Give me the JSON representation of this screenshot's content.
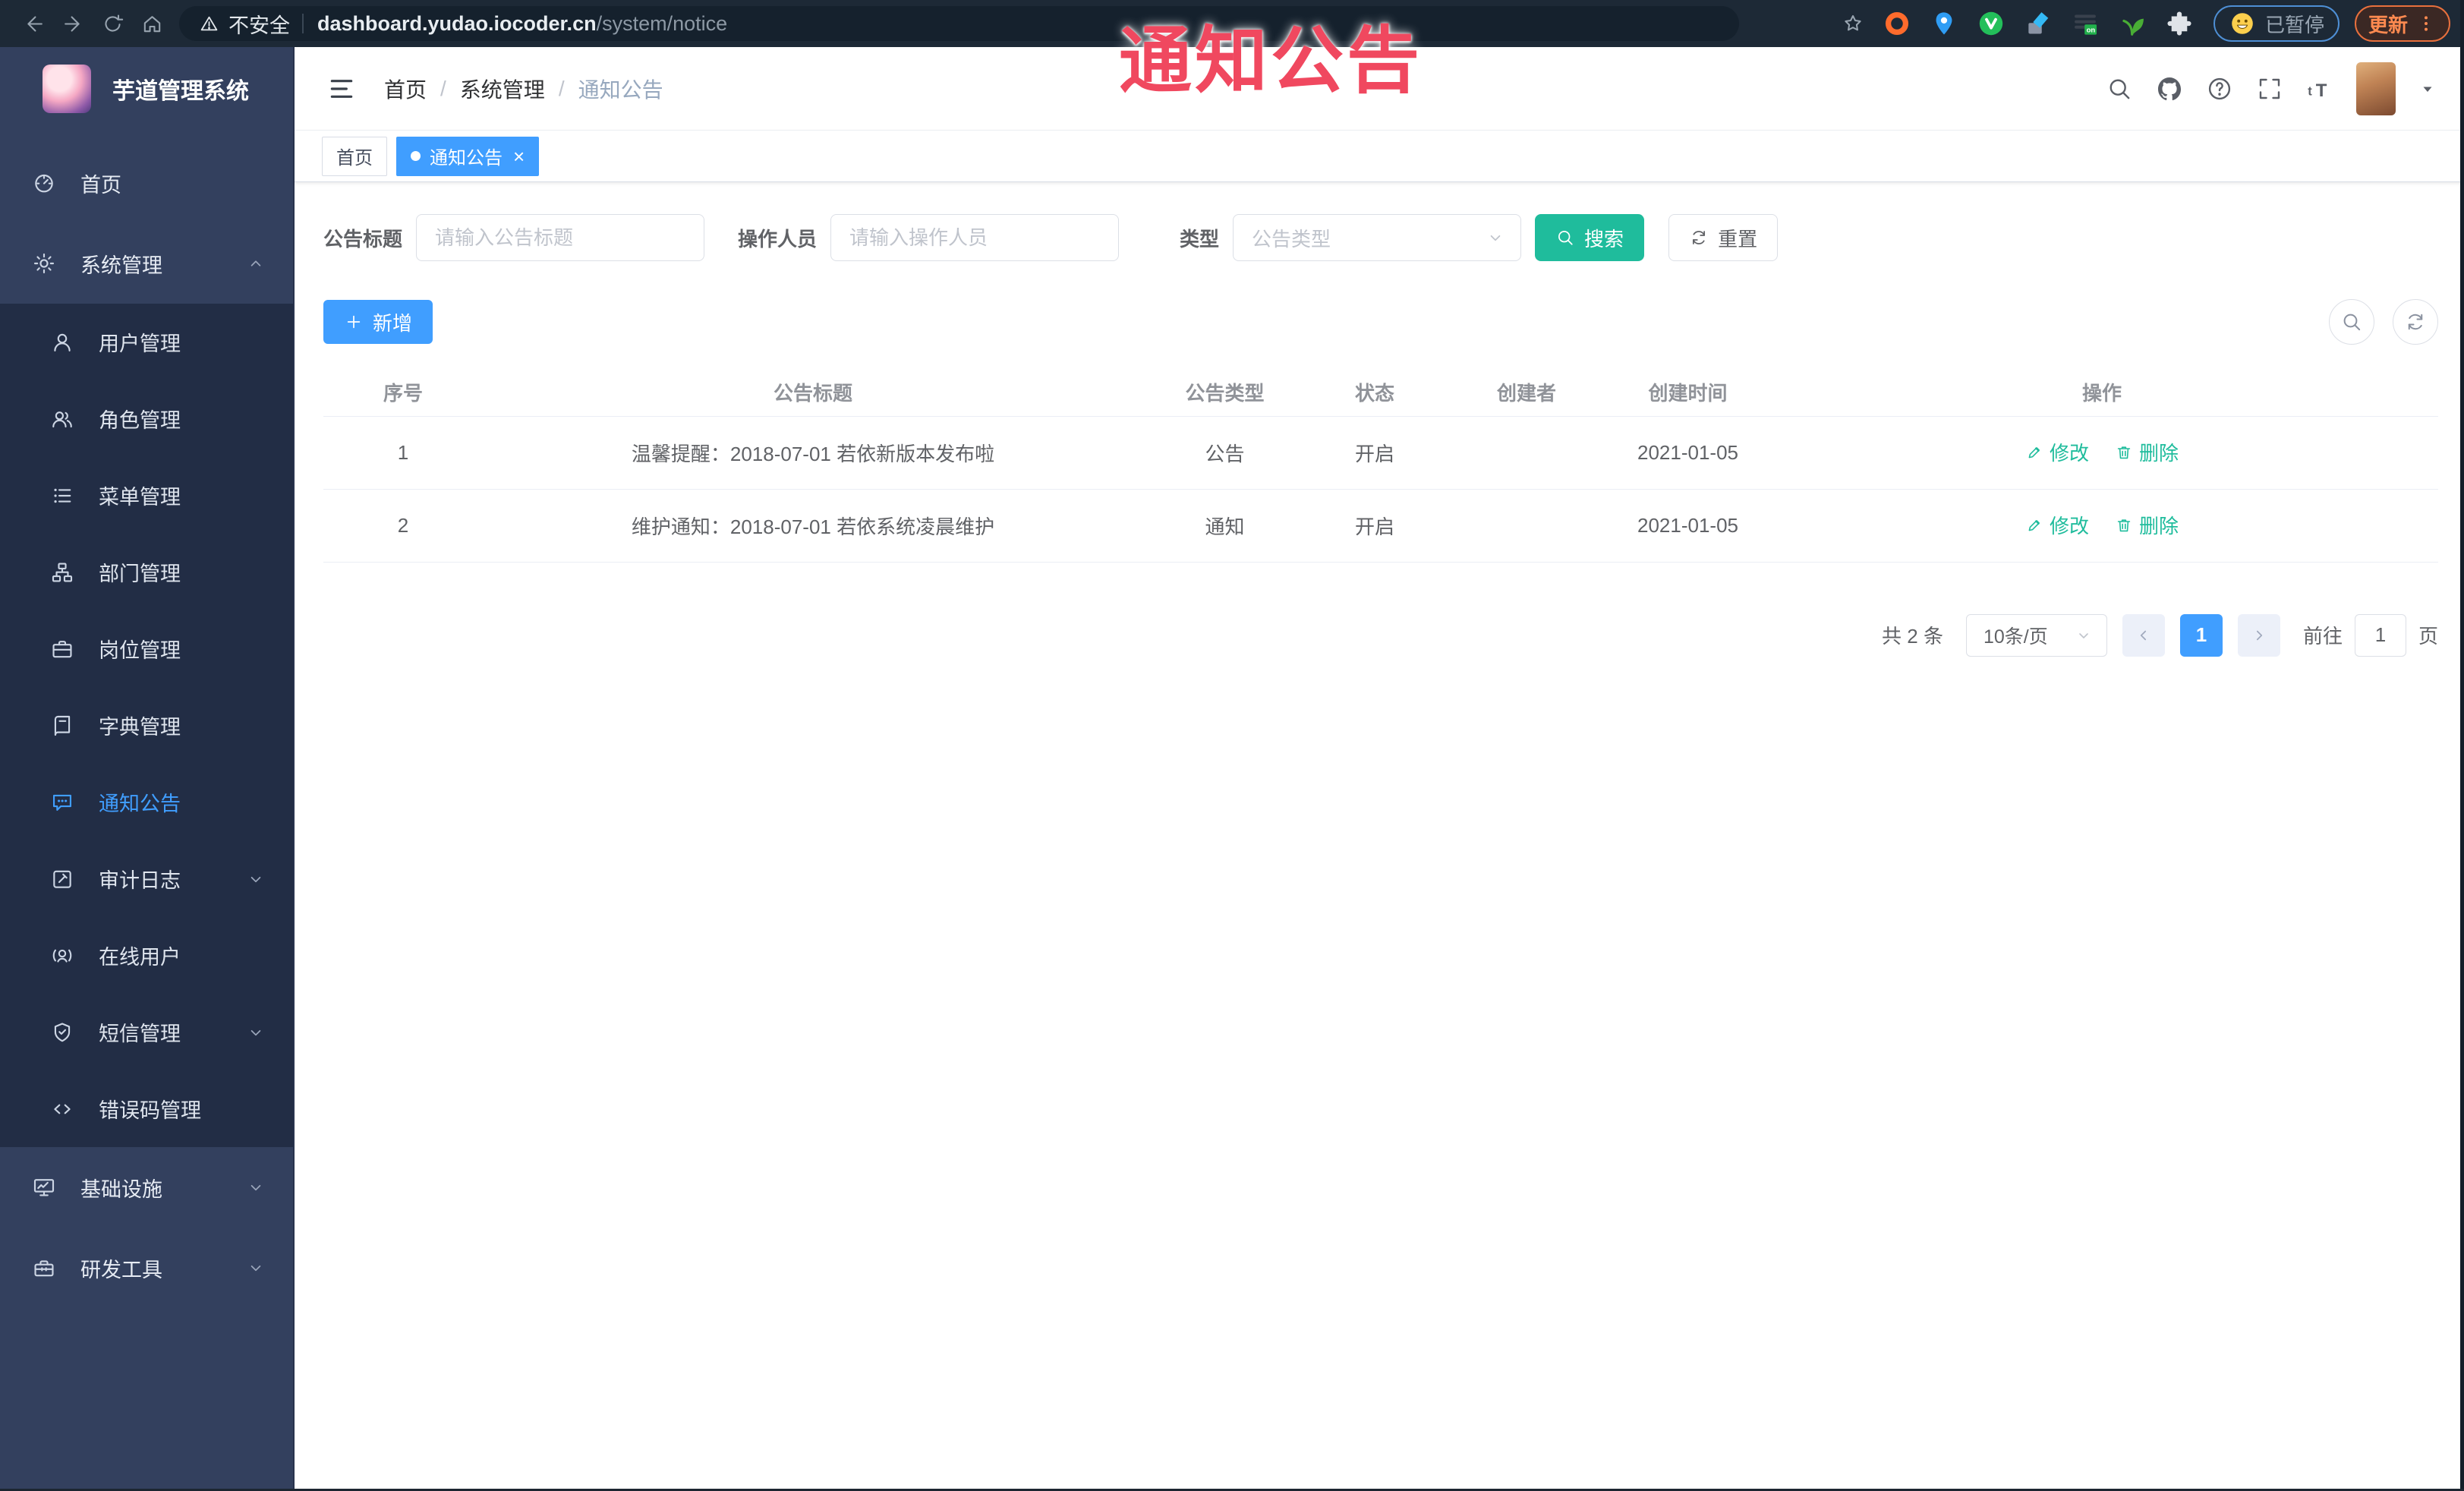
{
  "colors": {
    "accent": "#409eff",
    "teal": "#1fbc9c",
    "watermark": "#f0485f",
    "sidebar-bg": "#33405e",
    "submenu-bg": "#222d45",
    "browser-bar": "#1d2936"
  },
  "watermark_text": "通知公告",
  "browser": {
    "security_label": "不安全",
    "url_host": "dashboard.yudao.iocoder.cn",
    "url_path": "/system/notice",
    "extensions": [
      "orange-ring",
      "blue-pin",
      "green-circle",
      "blue-gem",
      "dark-stack",
      "green-sprout",
      "puzzle"
    ],
    "ext_badge": "on",
    "paused_label": "已暂停",
    "update_label": "更新"
  },
  "sidebar": {
    "logo_title": "芋道管理系统",
    "items": [
      {
        "key": "home",
        "label": "首页",
        "icon": "dashboard"
      },
      {
        "key": "system-mgmt",
        "label": "系统管理",
        "icon": "gear",
        "arrow": "up",
        "children": [
          {
            "key": "user-mgmt",
            "label": "用户管理",
            "icon": "user"
          },
          {
            "key": "role-mgmt",
            "label": "角色管理",
            "icon": "users"
          },
          {
            "key": "menu-mgmt",
            "label": "菜单管理",
            "icon": "menu-list"
          },
          {
            "key": "dept-mgmt",
            "label": "部门管理",
            "icon": "tree"
          },
          {
            "key": "post-mgmt",
            "label": "岗位管理",
            "icon": "briefcase"
          },
          {
            "key": "dict-mgmt",
            "label": "字典管理",
            "icon": "book"
          },
          {
            "key": "notice-announcement",
            "label": "通知公告",
            "icon": "notice",
            "active": true
          },
          {
            "key": "audit-log",
            "label": "审计日志",
            "icon": "log",
            "arrow": "down"
          },
          {
            "key": "online-users",
            "label": "在线用户",
            "icon": "online"
          },
          {
            "key": "sms-mgmt",
            "label": "短信管理",
            "icon": "sms",
            "arrow": "down"
          },
          {
            "key": "error-code-mgmt",
            "label": "错误码管理",
            "icon": "code"
          }
        ]
      },
      {
        "key": "infrastructure",
        "label": "基础设施",
        "icon": "monitor",
        "arrow": "down"
      },
      {
        "key": "dev-tools",
        "label": "研发工具",
        "icon": "toolbox",
        "arrow": "down"
      }
    ]
  },
  "navbar": {
    "breadcrumb": [
      "首页",
      "系统管理",
      "通知公告"
    ],
    "tools": [
      "search",
      "github",
      "question",
      "fullscreen",
      "font-size"
    ]
  },
  "tabs": [
    {
      "key": "home",
      "label": "首页",
      "active": false,
      "closable": false
    },
    {
      "key": "notice",
      "label": "通知公告",
      "active": true,
      "closable": true
    }
  ],
  "filters": {
    "title_label": "公告标题",
    "title_placeholder": "请输入公告标题",
    "operator_label": "操作人员",
    "operator_placeholder": "请输入操作人员",
    "type_label": "类型",
    "type_placeholder": "公告类型",
    "search_label": "搜索",
    "reset_label": "重置"
  },
  "toolbar": {
    "add_label": "新增"
  },
  "table": {
    "columns": [
      "序号",
      "公告标题",
      "公告类型",
      "状态",
      "创建者",
      "创建时间",
      "操作"
    ],
    "rows": [
      {
        "no": "1",
        "title": "温馨提醒：2018-07-01 若依新版本发布啦",
        "type": "公告",
        "status": "开启",
        "creator": "",
        "created": "2021-01-05"
      },
      {
        "no": "2",
        "title": "维护通知：2018-07-01 若依系统凌晨维护",
        "type": "通知",
        "status": "开启",
        "creator": "",
        "created": "2021-01-05"
      }
    ],
    "edit_label": "修改",
    "delete_label": "删除"
  },
  "pagination": {
    "total": "共 2 条",
    "page_size": "10条/页",
    "current": "1",
    "goto_label": "前往",
    "goto_value": "1",
    "page_unit": "页"
  }
}
